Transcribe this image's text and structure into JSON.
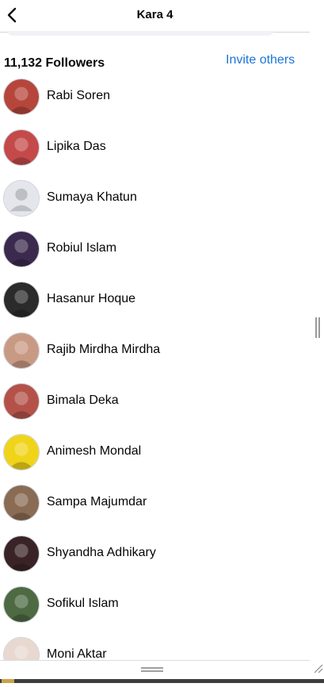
{
  "header": {
    "title": "Kara 4",
    "back_icon": "back-arrow-icon"
  },
  "followers": {
    "count_label": "11,132 Followers",
    "invite_label": "Invite others"
  },
  "list": [
    {
      "name": "Rabi Soren",
      "avatar": "photo-child-red",
      "color": "#b6463b"
    },
    {
      "name": "Lipika Das",
      "avatar": "photo-baby",
      "color": "#c44a4a"
    },
    {
      "name": "Sumaya Khatun",
      "avatar": "default-silhouette",
      "color": "#bcc0c4"
    },
    {
      "name": "Robiul Islam",
      "avatar": "photo-night-moon",
      "color": "#3b2a4e"
    },
    {
      "name": "Hasanur Hoque",
      "avatar": "photo-logo-dark",
      "color": "#2b2b2b"
    },
    {
      "name": "Rajib Mirdha Mirdha",
      "avatar": "photo-child",
      "color": "#c99a83"
    },
    {
      "name": "Bimala Deka",
      "avatar": "photo-woman-red",
      "color": "#b4524a"
    },
    {
      "name": "Animesh Mondal",
      "avatar": "photo-yellow-flowers",
      "color": "#f0d41a"
    },
    {
      "name": "Sampa Majumdar",
      "avatar": "photo-couple",
      "color": "#8a6b53"
    },
    {
      "name": "Shyandha Adhikary",
      "avatar": "photo-woman-dark",
      "color": "#3a2326"
    },
    {
      "name": "Sofikul Islam",
      "avatar": "photo-man-field",
      "color": "#4d6a43"
    },
    {
      "name": "Moni Aktar",
      "avatar": "photo-woman-light",
      "color": "#e8d8d0"
    }
  ]
}
